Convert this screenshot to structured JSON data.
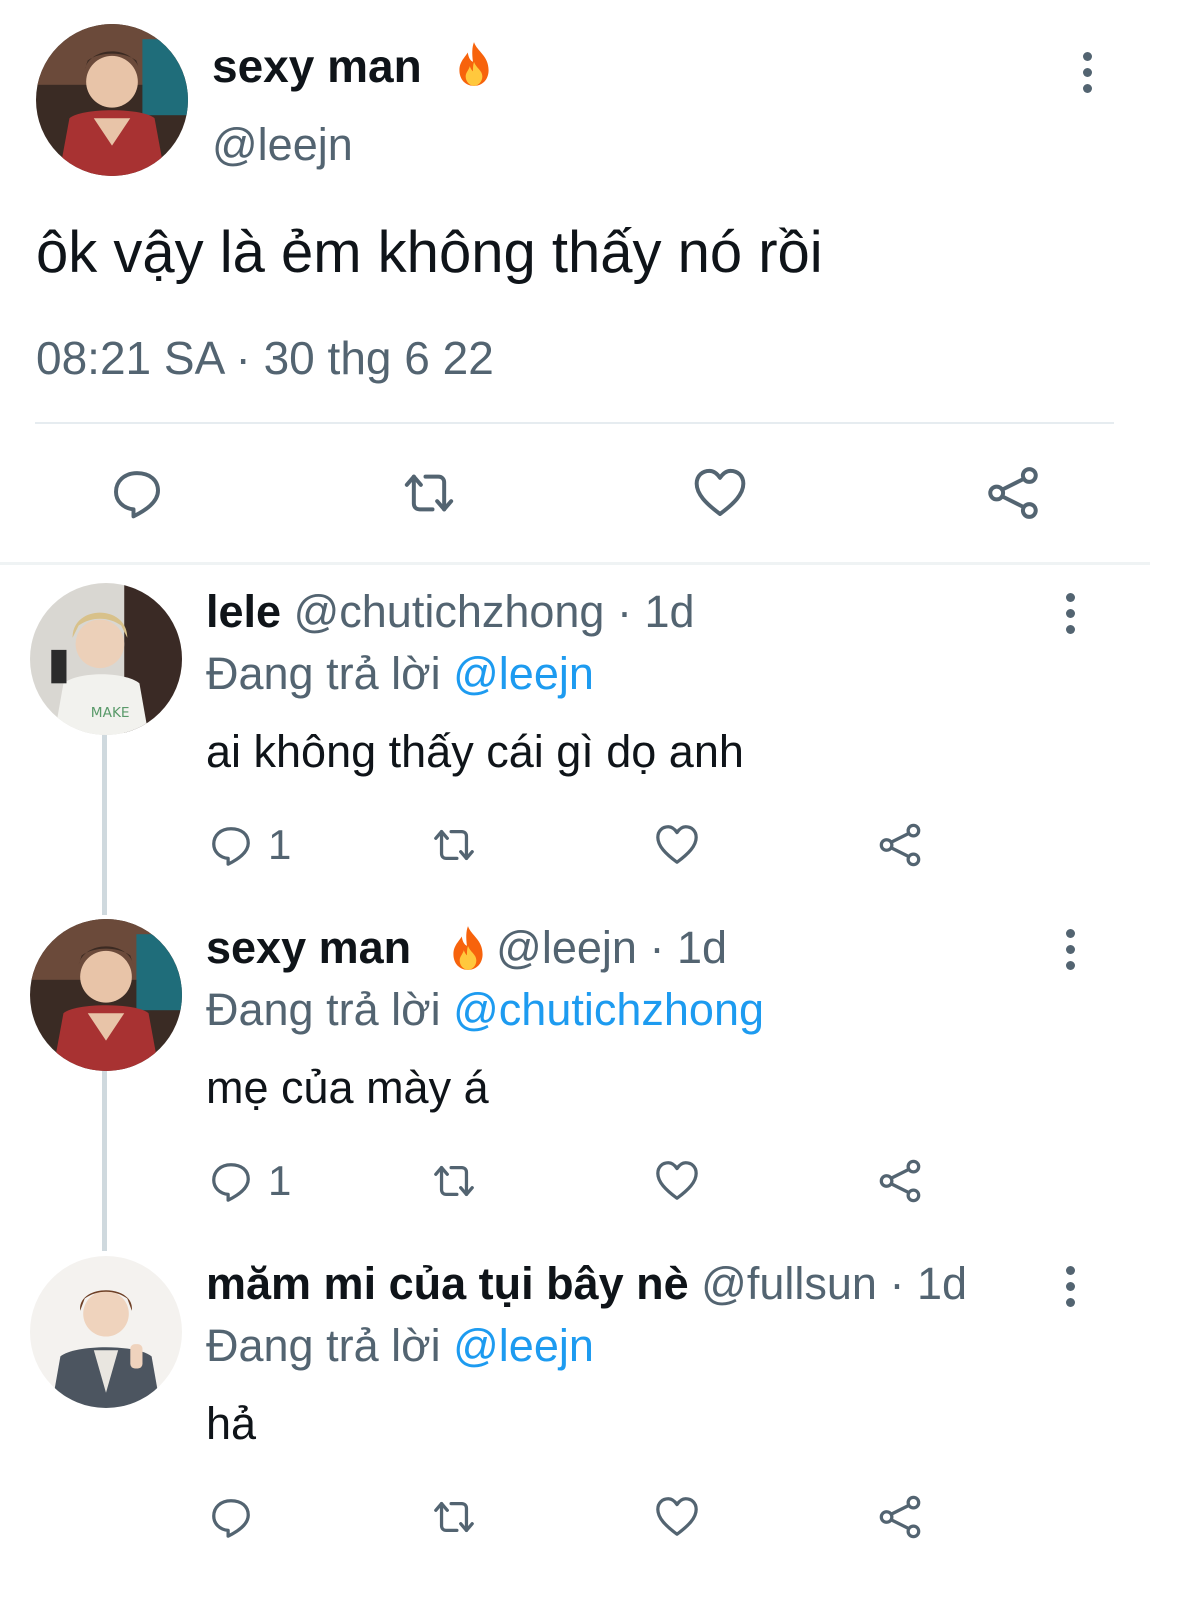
{
  "main_tweet": {
    "display_name": "sexy man",
    "emoji": "🔥",
    "handle": "@leejn",
    "text": "ôk vậy là ẻm không thấy nó rồi",
    "timestamp": "08:21 SA · 30 thg 6 22"
  },
  "replies": [
    {
      "display_name": "lele",
      "handle": "@chutichzhong",
      "age": "· 1d",
      "replying_prefix": "Đang trả lời",
      "replying_to": "@leejn",
      "text": "ai không thấy cái gì dọ anh",
      "reply_count": "1"
    },
    {
      "display_name": "sexy man",
      "emoji": "🔥",
      "handle": "@leejn",
      "age": "· 1d",
      "replying_prefix": "Đang trả lời",
      "replying_to": "@chutichzhong",
      "text": "mẹ của mày á",
      "reply_count": "1"
    },
    {
      "display_name": "măm mi của tụi bây nè",
      "handle": "@fullsun",
      "age": "· 1d",
      "replying_prefix": "Đang trả lời",
      "replying_to": "@leejn",
      "text": "hả",
      "reply_count": ""
    }
  ],
  "colors": {
    "text": "#0f1419",
    "muted": "#536471",
    "link": "#1d9bf0",
    "thread_line": "#cfd9de",
    "divider": "#e6ecf0"
  },
  "icons": [
    "more-icon",
    "reply-icon",
    "retweet-icon",
    "like-icon",
    "share-icon",
    "fire-emoji"
  ]
}
